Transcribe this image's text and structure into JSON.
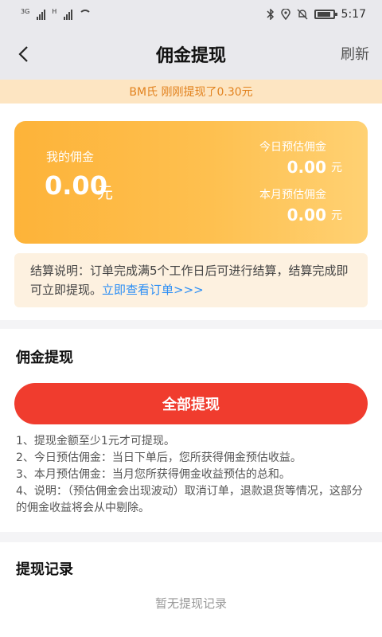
{
  "status_bar": {
    "network_1": "3G",
    "network_2": "H",
    "time": "5:17",
    "icons": [
      "bluetooth-icon",
      "location-icon",
      "mute-bell-icon",
      "battery-icon"
    ]
  },
  "nav": {
    "title": "佣金提现",
    "refresh_label": "刷新",
    "back_icon": "chevron-left-icon"
  },
  "ticker": {
    "text": "BM氏 刚刚提现了0.30元"
  },
  "card": {
    "my_label": "我的佣金",
    "my_amount": "0.00",
    "my_unit": "元",
    "today_label": "今日预估佣金",
    "today_amount": "0.00",
    "today_unit": "元",
    "month_label": "本月预估佣金",
    "month_amount": "0.00",
    "month_unit": "元",
    "gradient_start": "#fdb339",
    "gradient_end": "#ffd173"
  },
  "notice": {
    "text": "结算说明：订单完成满5个工作日后可进行结算，结算完成即可立即提现。",
    "link_text": "立即查看订单>>>"
  },
  "withdraw": {
    "section_title": "佣金提现",
    "button_label": "全部提现",
    "button_color": "#f03c2e",
    "rules": [
      "1、提现金额至少1元才可提现。",
      "2、今日预估佣金：当日下单后，您所获得佣金预估收益。",
      "3、本月预估佣金：当月您所获得佣金收益预估的总和。",
      "4、说明：（预估佣金会出现波动）取消订单，退款退货等情况，这部分的佣金收益将会从中剔除。"
    ]
  },
  "records": {
    "section_title": "提现记录",
    "empty_text": "暂无提现记录"
  }
}
